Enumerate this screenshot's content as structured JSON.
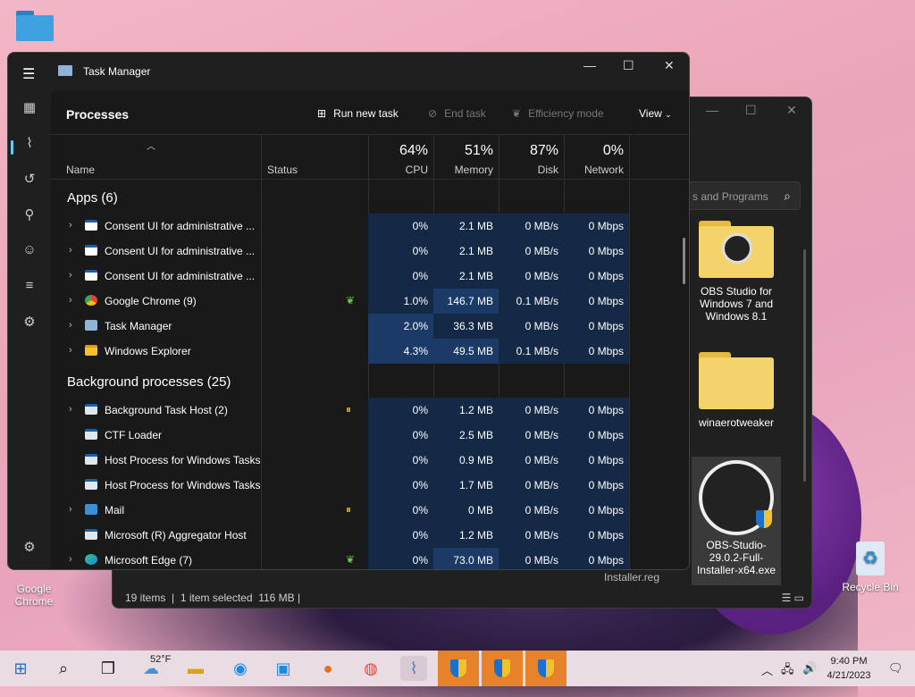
{
  "desktop": {
    "icons": [
      {
        "label": "Google Chrome"
      },
      {
        "label": "Recycle Bin"
      }
    ]
  },
  "explorer": {
    "search_placeholder": "s and Programs",
    "files": [
      {
        "label": "OBS Studio for Windows 7 and Windows 8.1"
      },
      {
        "label": "winaerotweaker"
      },
      {
        "label": "OBS-Studio-29.0.2-Full-Installer-x64.exe"
      }
    ],
    "partial_file": "Installer.reg",
    "status": {
      "items": "19 items",
      "selected": "1 item selected",
      "size": "116 MB"
    }
  },
  "taskmanager": {
    "title": "Task Manager",
    "page_title": "Processes",
    "toolbar": {
      "run_new_task": "Run new task",
      "end_task": "End task",
      "efficiency_mode": "Efficiency mode",
      "view": "View"
    },
    "headers": {
      "name": "Name",
      "status": "Status",
      "cpu_pct": "64%",
      "cpu": "CPU",
      "mem_pct": "51%",
      "mem": "Memory",
      "disk_pct": "87%",
      "disk": "Disk",
      "net_pct": "0%",
      "net": "Network"
    },
    "groups": {
      "apps": "Apps (6)",
      "background": "Background processes (25)"
    },
    "rows": [
      {
        "name": "Consent UI for administrative ...",
        "cpu": "0%",
        "mem": "2.1 MB",
        "disk": "0 MB/s",
        "net": "0 Mbps"
      },
      {
        "name": "Consent UI for administrative ...",
        "cpu": "0%",
        "mem": "2.1 MB",
        "disk": "0 MB/s",
        "net": "0 Mbps"
      },
      {
        "name": "Consent UI for administrative ...",
        "cpu": "0%",
        "mem": "2.1 MB",
        "disk": "0 MB/s",
        "net": "0 Mbps"
      },
      {
        "name": "Google Chrome (9)",
        "cpu": "1.0%",
        "mem": "146.7 MB",
        "disk": "0.1 MB/s",
        "net": "0 Mbps"
      },
      {
        "name": "Task Manager",
        "cpu": "2.0%",
        "mem": "36.3 MB",
        "disk": "0 MB/s",
        "net": "0 Mbps"
      },
      {
        "name": "Windows Explorer",
        "cpu": "4.3%",
        "mem": "49.5 MB",
        "disk": "0.1 MB/s",
        "net": "0 Mbps"
      },
      {
        "name": "Background Task Host (2)",
        "cpu": "0%",
        "mem": "1.2 MB",
        "disk": "0 MB/s",
        "net": "0 Mbps"
      },
      {
        "name": "CTF Loader",
        "cpu": "0%",
        "mem": "2.5 MB",
        "disk": "0 MB/s",
        "net": "0 Mbps"
      },
      {
        "name": "Host Process for Windows Tasks",
        "cpu": "0%",
        "mem": "0.9 MB",
        "disk": "0 MB/s",
        "net": "0 Mbps"
      },
      {
        "name": "Host Process for Windows Tasks",
        "cpu": "0%",
        "mem": "1.7 MB",
        "disk": "0 MB/s",
        "net": "0 Mbps"
      },
      {
        "name": "Mail",
        "cpu": "0%",
        "mem": "0 MB",
        "disk": "0 MB/s",
        "net": "0 Mbps"
      },
      {
        "name": "Microsoft (R) Aggregator Host",
        "cpu": "0%",
        "mem": "1.2 MB",
        "disk": "0 MB/s",
        "net": "0 Mbps"
      },
      {
        "name": "Microsoft Edge (7)",
        "cpu": "0%",
        "mem": "73.0 MB",
        "disk": "0 MB/s",
        "net": "0 Mbps"
      }
    ]
  },
  "taskbar": {
    "weather": "52°F",
    "time": "9:40 PM",
    "date": "4/21/2023"
  }
}
